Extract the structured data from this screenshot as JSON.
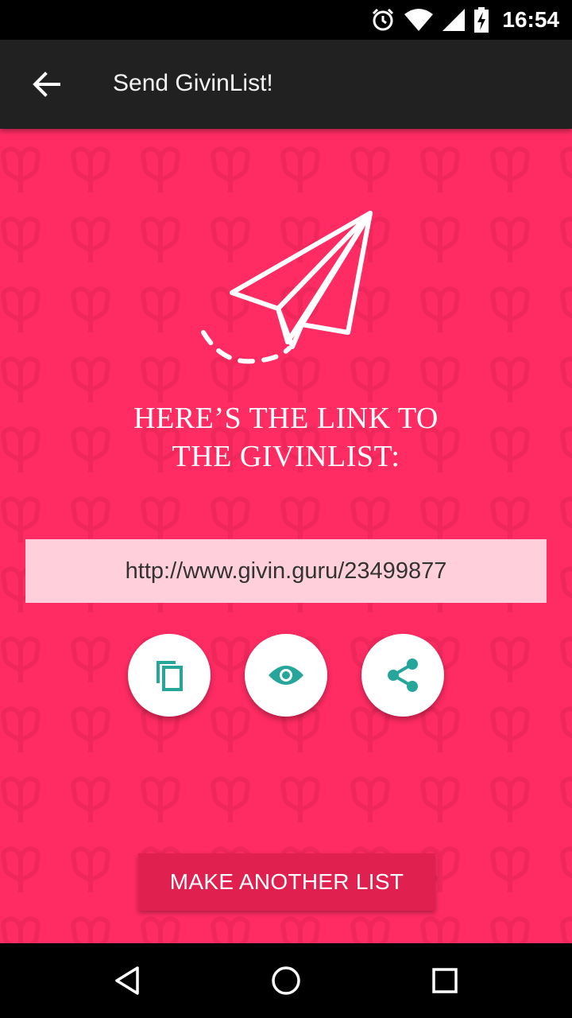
{
  "status_bar": {
    "time": "16:54",
    "icons": [
      "alarm-icon",
      "wifi-icon",
      "signal-icon",
      "battery-charging-icon"
    ]
  },
  "app_bar": {
    "back_icon": "arrow-back-icon",
    "title": "Send GivinList!"
  },
  "main": {
    "illustration": "paper-plane-icon",
    "headline_line1": "HERE’S THE LINK TO",
    "headline_line2": "THE GIVINLIST:",
    "link": "http://www.givin.guru/23499877",
    "actions": [
      {
        "icon": "copy-icon"
      },
      {
        "icon": "eye-icon"
      },
      {
        "icon": "share-icon"
      }
    ],
    "make_another_label": "MAKE ANOTHER LIST"
  },
  "nav_bar": {
    "icons": [
      "nav-back-icon",
      "nav-home-icon",
      "nav-recent-icon"
    ]
  },
  "colors": {
    "background": "#ff2c63",
    "app_bar": "#212121",
    "link_box": "#ffd0dc",
    "button": "#e0204f",
    "icon_teal": "#26a69a"
  }
}
